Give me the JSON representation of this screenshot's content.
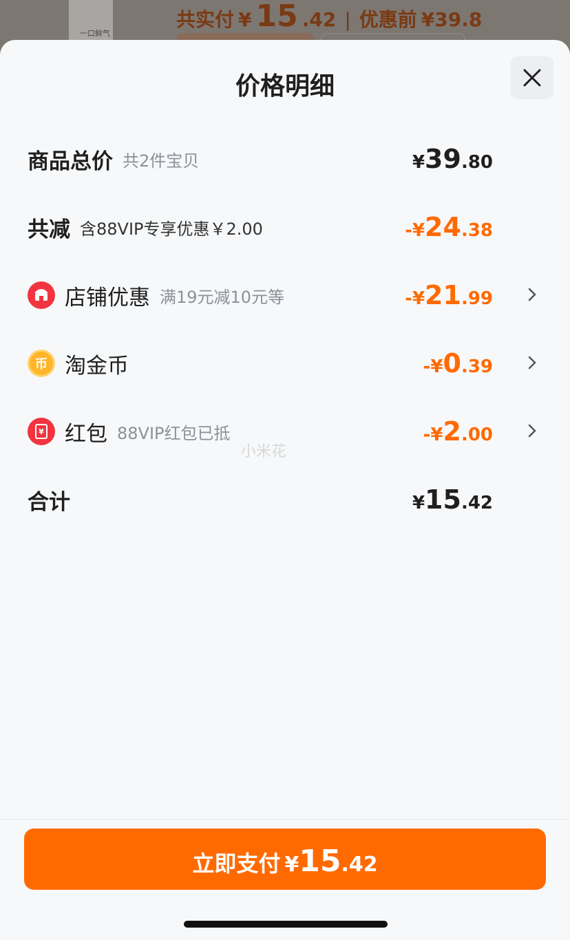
{
  "background": {
    "product_label": "一口鲜气",
    "paid_prefix": "共实付",
    "paid_symbol": "¥",
    "paid_int": "15",
    "paid_dec": ".42",
    "before_label": "优惠前",
    "before_price": "¥39.8"
  },
  "sheet": {
    "title": "价格明细",
    "close_icon": "close-icon"
  },
  "rows": {
    "total": {
      "label": "商品总价",
      "sub": "共2件宝贝",
      "sym": "¥",
      "int": "39",
      "dec": ".80"
    },
    "reduce": {
      "label": "共减",
      "sub": "含88VIP专享优惠￥2.00",
      "sym": "-¥",
      "int": "24",
      "dec": ".38"
    },
    "store": {
      "label": "店铺优惠",
      "sub": "满19元减10元等",
      "sym": "-¥",
      "int": "21",
      "dec": ".99",
      "icon": "store-icon"
    },
    "coin": {
      "label": "淘金币",
      "sub": "",
      "sym": "-¥",
      "int": "0",
      "dec": ".39",
      "icon": "coin-icon"
    },
    "redpacket": {
      "label": "红包",
      "sub": "88VIP红包已抵",
      "sym": "-¥",
      "int": "2",
      "dec": ".00",
      "icon": "red-packet-icon"
    },
    "sum": {
      "label": "合计",
      "sym": "¥",
      "int": "15",
      "dec": ".42"
    }
  },
  "watermark": "小米花",
  "pay_button": {
    "label": "立即支付",
    "sym": "¥",
    "int": "15",
    "dec": ".42"
  },
  "colors": {
    "accent": "#ff6a00",
    "text": "#1f1f1f",
    "muted": "#8c9099"
  }
}
